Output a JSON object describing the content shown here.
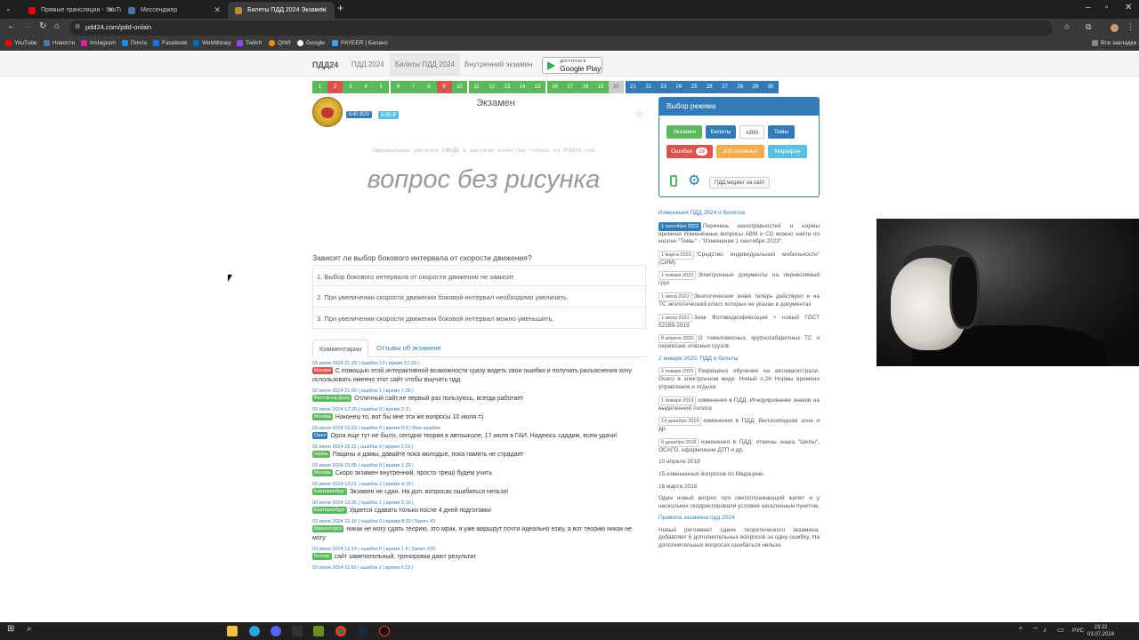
{
  "browser": {
    "tabs": [
      {
        "label": "Прямые трансляции - YouTube",
        "color": "#ff0000",
        "active": false
      },
      {
        "label": "Мессенджер",
        "color": "#4a76a8",
        "active": false
      },
      {
        "label": "Билеты ПДД 2024 Экзамен П...",
        "color": "#c58b2a",
        "active": true
      }
    ],
    "url": "pdd24.com/pdd-onlain",
    "bookmarks": [
      {
        "label": "YouTube",
        "color": "#ff0000"
      },
      {
        "label": "Новости",
        "color": "#4a76a8"
      },
      {
        "label": "Instagram",
        "color": "#d6249f"
      },
      {
        "label": "Почта",
        "color": "#1e88e5"
      },
      {
        "label": "Facebook",
        "color": "#1877f2"
      },
      {
        "label": "WebMoney",
        "color": "#036cb5"
      },
      {
        "label": "Twitch",
        "color": "#9146ff"
      },
      {
        "label": "QIWI",
        "color": "#ff8c00"
      },
      {
        "label": "Google",
        "color": "#ffffff"
      },
      {
        "label": "PAYEER | Баланс",
        "color": "#3aa0ff"
      }
    ],
    "all_bookmarks": "Все закладки"
  },
  "site": {
    "nav": [
      "ПДД24",
      "ПДД 2024",
      "Билеты ПДД 2024",
      "Внутренний экзамен"
    ],
    "gplay_small": "ДОСТУПНО В",
    "gplay_big": "Google Play",
    "tickets": [
      {
        "n": "1",
        "s": "g"
      },
      {
        "n": "2",
        "s": "r"
      },
      {
        "n": "3",
        "s": "g"
      },
      {
        "n": "4",
        "s": "g"
      },
      {
        "n": "5",
        "s": "g"
      },
      {
        "n": "6",
        "s": "g"
      },
      {
        "n": "7",
        "s": "g"
      },
      {
        "n": "8",
        "s": "g"
      },
      {
        "n": "9",
        "s": "r"
      },
      {
        "n": "10",
        "s": "g"
      },
      {
        "n": "11",
        "s": "g"
      },
      {
        "n": "12",
        "s": "g"
      },
      {
        "n": "13",
        "s": "g"
      },
      {
        "n": "14",
        "s": "g"
      },
      {
        "n": "15",
        "s": "g"
      },
      {
        "n": "16",
        "s": "g"
      },
      {
        "n": "17",
        "s": "g"
      },
      {
        "n": "18",
        "s": "g"
      },
      {
        "n": "19",
        "s": "g"
      },
      {
        "n": "20",
        "s": "n"
      },
      {
        "n": "21",
        "s": "b"
      },
      {
        "n": "22",
        "s": "b"
      },
      {
        "n": "23",
        "s": "b"
      },
      {
        "n": "24",
        "s": "b"
      },
      {
        "n": "25",
        "s": "b"
      },
      {
        "n": "26",
        "s": "b"
      },
      {
        "n": "27",
        "s": "b"
      },
      {
        "n": "28",
        "s": "b"
      },
      {
        "n": "29",
        "s": "b"
      },
      {
        "n": "30",
        "s": "b"
      }
    ],
    "badge_book": "Б30 В20",
    "badge_price": "6:35 ₽",
    "exam_title": "Экзамен",
    "watermark": "Официальные рисунки ГИБДД в высоком качестве только на Pdd24.com",
    "no_picture": "вопрос без рисунка",
    "question": "Зависит ли выбор бокового интервала от скорости движения?",
    "answers": [
      "1. Выбор бокового интервала от скорости движения не зависит.",
      "2. При увеличении скорости движения боковой интервал необходимо увеличить.",
      "3. При увеличении скорости движения боковой интервал можно уменьшить."
    ],
    "comment_tabs": [
      "Комментарии",
      "Отзывы об экзамене"
    ],
    "comments": [
      {
        "meta": "03 июля 2024 21:29 | ошибок 13 | время 17:29 |",
        "city": "Москва",
        "city_color": "#d9534f",
        "text": "С помощью этой интерактивной возможности сразу видеть свои ошибки и получать разъяснения хочу использовать именно этот сайт чтобы выучить пдд"
      },
      {
        "meta": "03 июля 2024 21:00 | ошибок 1 | время 7:26 |",
        "city": "Ростов-на-Дону",
        "city_color": "#5cb85c",
        "text": "Отличный сайт,не первый раз пользуюсь, всегда работает"
      },
      {
        "meta": "03 июля 2024 17:35 | ошибок 8 | время 2:1 |",
        "city": "Москва",
        "city_color": "#5cb85c",
        "text": "Наконец-то, вот бы мне эти же вопросы 10 июля =)"
      },
      {
        "meta": "03 июля 2024 15:29 | ошибок 0 | время 0:9 | Мои ошибки",
        "city": "Орел",
        "city_color": "#337ab7",
        "text": "Орла еще тут не было, сегодня теория в автошколе, 17 июля в ГАИ. Надеюсь сдадим, всем удачи!"
      },
      {
        "meta": "03 июля 2024 15:11 | ошибок 0 | время 2:16 |",
        "city": "пермь",
        "city_color": "#5cb85c",
        "text": "Пацаны и дамы, давайте пока молодые, пока память не страдает"
      },
      {
        "meta": "03 июля 2024 15:05 | ошибок 0 | время 1:33 |",
        "city": "Москва",
        "city_color": "#5cb85c",
        "text": "Скоро экзамен внутренний, просто треш) будем учить"
      },
      {
        "meta": "03 июля 2024 13:21 | ошибок 2 | время 4:18 |",
        "city": "Екатеринбург",
        "city_color": "#5cb85c",
        "text": "Экзамен не сдан. На доп. вопросах ошибаться нельзя!"
      },
      {
        "meta": "03 июля 2024 12:35 | ошибок 1 | время 5:10 |",
        "city": "Екатеринбург",
        "city_color": "#5cb85c",
        "text": "Удается сдавать только после 4 дней подготовки"
      },
      {
        "meta": "03 июля 2024 12:16 | ошибок 0 | время 8:30 | Билет 49",
        "city": "Красногорск",
        "city_color": "#5cb85c",
        "text": "никак не могу сдать теорию, это мрак, я уже маршрут почти идеально езжу, а вот теорию никак не могу"
      },
      {
        "meta": "03 июля 2024 12:14 | ошибок 0 | время 1:6 | Билет #20",
        "city": "Котлас",
        "city_color": "#5cb85c",
        "text": "сайт замечательный, тренировки дают результат"
      },
      {
        "meta": "03 июля 2024 11:50 | ошибок 1 | время 6:15 |",
        "city": "",
        "city_color": "#5cb85c",
        "text": ""
      }
    ],
    "mode": {
      "title": "Выбор режима",
      "buttons": [
        {
          "label": "Экзамен",
          "color": "#5cb85c"
        },
        {
          "label": "Билеты",
          "color": "#337ab7"
        },
        {
          "label": "ABM",
          "color": "#ffffff"
        },
        {
          "label": "Темы",
          "color": "#337ab7"
        },
        {
          "label": "Ошибки",
          "color": "#d9534f"
        },
        {
          "label": "100 сложных",
          "color": "#f0ad4e"
        },
        {
          "label": "Марафон",
          "color": "#5bc0de"
        }
      ],
      "errors_count": "28",
      "widget": "ПДД виджет на сайт"
    },
    "news": [
      {
        "date": "",
        "text": "Изменения ПДД 2024 и билетов"
      },
      {
        "date": "1 сентября 2023",
        "blue": true,
        "text": "Перечень неисправностей и нормы времени Изменённые вопросы ABM и CD можно найти по кнопке \"Темы\" - \"Изменения 1 сентября 2023\"."
      },
      {
        "date": "1 марта 2023",
        "text": "\"Средство индивидуальной мобильности\" (СИМ)"
      },
      {
        "date": "1 января 2022",
        "text": "Электронные документы на перевозимый груз"
      },
      {
        "date": "1 июля 2021",
        "text": "Экологические знаки теперь действуют и на ТС экологический класс которых не указан в документах"
      },
      {
        "date": "1 июля 2021",
        "text": "Знак Фотовидеофиксация + новый ГОСТ 52289-2019"
      },
      {
        "date": "8 апреля 2020",
        "text": "О тяжеловесных, крупногабаритных ТС и перевозке опасных грузов."
      },
      {
        "date": "",
        "text": "2 января 2020: ПДД и билеты"
      },
      {
        "date": "2 января 2020",
        "text": "Разрешено обучение на автомагистрали. Осаго в электронном виде. Новый п.26 Нормы времени управления и отдыха"
      },
      {
        "date": "1 января 2019",
        "text": "изменения в ПДД: Игнорирование знаков на выделенной полосе"
      },
      {
        "date": "14 декабря 2018",
        "text": "изменения в ПДД: Велосипедная зона и др."
      },
      {
        "date": "6 декабря 2018",
        "text": "изменения в ПДД: отмены знака \"Шипы\", ОСАГО, оформление ДТП и др."
      },
      {
        "date": "",
        "text": "10 апреля 2018"
      },
      {
        "date": "",
        "text": "15 измененных вопросов по Медицине."
      },
      {
        "date": "",
        "text": "18 марта 2018"
      },
      {
        "date": "",
        "text": "Один новый вопрос про светоотражающий жилет и у нескольких скорректировали условия населенным пунктом."
      },
      {
        "date": "",
        "text": "Правила экзамена пдд 2024"
      },
      {
        "date": "",
        "text": "Новый регламент сдачи теоретического экзамена, добавляет 5 дополнительных вопросов за одну ошибку. На дополнительных вопросах ошибаться нельзя."
      }
    ]
  },
  "taskbar": {
    "lang": "РУС",
    "time": "23:22",
    "date": "03.07.2024"
  }
}
